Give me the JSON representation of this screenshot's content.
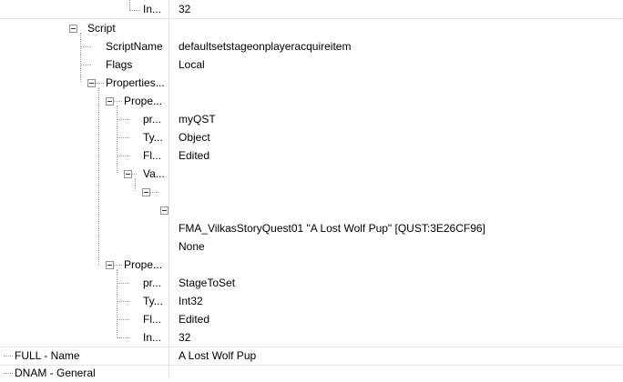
{
  "tree": {
    "rows": [
      {
        "name": "In...",
        "value": "32"
      },
      {
        "name": "Script",
        "value": ""
      },
      {
        "name": "ScriptName",
        "value": "defaultsetstageonplayeracquireitem"
      },
      {
        "name": "Flags",
        "value": "Local"
      },
      {
        "name": "Properties...",
        "value": ""
      },
      {
        "name": "Prope...",
        "value": ""
      },
      {
        "name": "pr...",
        "value": "myQST"
      },
      {
        "name": "Ty...",
        "value": "Object"
      },
      {
        "name": "Fl...",
        "value": "Edited"
      },
      {
        "name": "Va...",
        "value": ""
      },
      {
        "name": "",
        "value": ""
      },
      {
        "name": "",
        "value": ""
      },
      {
        "name": "",
        "value": "FMA_VilkasStoryQuest01 \"A Lost Wolf Pup\" [QUST:3E26CF96]"
      },
      {
        "name": "",
        "value": "None"
      },
      {
        "name": "Prope...",
        "value": ""
      },
      {
        "name": "pr...",
        "value": "StageToSet"
      },
      {
        "name": "Ty...",
        "value": "Int32"
      },
      {
        "name": "Fl...",
        "value": "Edited"
      },
      {
        "name": "In...",
        "value": "32"
      },
      {
        "name": "FULL - Name",
        "value": "A Lost Wolf Pup"
      },
      {
        "name": "DNAM - General",
        "value": ""
      }
    ]
  }
}
